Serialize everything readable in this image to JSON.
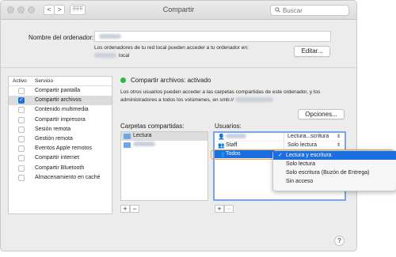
{
  "window": {
    "title": "Compartir"
  },
  "toolbar": {
    "back_label": "<",
    "forward_label": ">",
    "grid_label": "⠿⠿⠿"
  },
  "search": {
    "placeholder": "Buscar",
    "icon": "magnifier-icon"
  },
  "computer_name": {
    "label": "Nombre del ordenador:",
    "description_line1": "Los ordenadores de tu red local pueden acceder a tu ordenador en:",
    "description_line2": "local",
    "edit_button": "Editar..."
  },
  "services": {
    "header_active": "Activo",
    "header_service": "Servicio",
    "items": [
      {
        "label": "Compartir pantalla",
        "checked": false
      },
      {
        "label": "Compartir archivos",
        "checked": true
      },
      {
        "label": "Contenido multimedia",
        "checked": false
      },
      {
        "label": "Compartir impresora",
        "checked": false
      },
      {
        "label": "Sesión remota",
        "checked": false
      },
      {
        "label": "Gestión remota",
        "checked": false
      },
      {
        "label": "Eventos Apple remotos",
        "checked": false
      },
      {
        "label": "Compartir internet",
        "checked": false
      },
      {
        "label": "Compartir Bluetooth",
        "checked": false
      },
      {
        "label": "Almacenamiento en caché",
        "checked": false
      }
    ]
  },
  "status": {
    "text": "Compartir archivos: activado",
    "color": "#2fb944",
    "desc_line1": "Los otros usuarios pueden acceder a las carpetas compartidas de este ordenador, y los",
    "desc_line2": "administradores a todos los volúmenes, en smb://"
  },
  "options_button": "Opciones...",
  "shared_folders": {
    "label": "Carpetas compartidas:",
    "items": [
      "Lectura"
    ]
  },
  "users": {
    "label": "Usuarios:",
    "rows": [
      {
        "name": "",
        "perm": "Lectura...scritura"
      },
      {
        "name": "Staff",
        "perm": "Solo lectura"
      },
      {
        "name": "Todos",
        "perm": ""
      }
    ]
  },
  "permission_menu": {
    "items": [
      {
        "label": "Lectura y escritura",
        "selected": true
      },
      {
        "label": "Solo lectura",
        "selected": false
      },
      {
        "label": "Solo escritura (Buzón de Entrega)",
        "selected": false
      },
      {
        "label": "Sin acceso",
        "selected": false
      }
    ]
  },
  "buttons": {
    "add": "+",
    "remove": "−",
    "help": "?"
  },
  "colors": {
    "accent": "#1c6fe0",
    "highlight": "#f0a150"
  }
}
